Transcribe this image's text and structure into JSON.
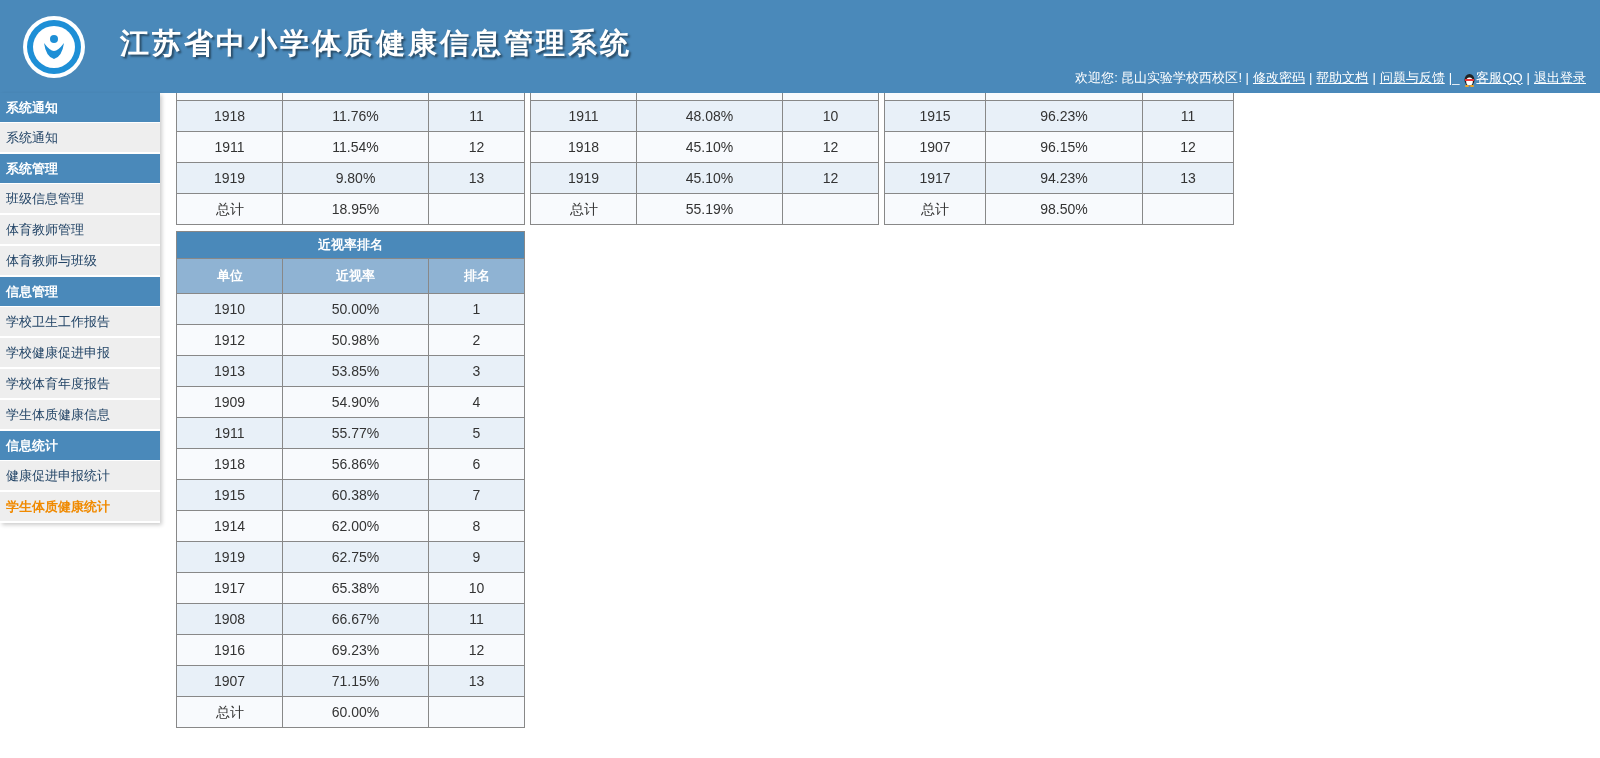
{
  "header": {
    "title": "江苏省中小学体质健康信息管理系统",
    "user_bar": [
      {
        "kind": "text",
        "text": "欢迎您: 昆山实验学校西校区! |"
      },
      {
        "kind": "link",
        "text": "修改密码"
      },
      {
        "kind": "text",
        "text": "|"
      },
      {
        "kind": "link",
        "text": "帮助文档"
      },
      {
        "kind": "text",
        "text": "|"
      },
      {
        "kind": "link",
        "text": "问题与反馈"
      },
      {
        "kind": "text",
        "text": "|_"
      },
      {
        "kind": "qq_link",
        "text": "客服QQ"
      },
      {
        "kind": "text",
        "text": "|"
      },
      {
        "kind": "link",
        "text": "退出登录"
      }
    ]
  },
  "sidebar": {
    "items": [
      {
        "kind": "section",
        "label": "系统通知",
        "selected": false
      },
      {
        "kind": "item",
        "label": "系统通知",
        "selected": false
      },
      {
        "kind": "section",
        "label": "系统管理",
        "selected": false
      },
      {
        "kind": "item",
        "label": "班级信息管理",
        "selected": false
      },
      {
        "kind": "item",
        "label": "体育教师管理",
        "selected": false
      },
      {
        "kind": "item",
        "label": "体育教师与班级",
        "selected": false
      },
      {
        "kind": "section",
        "label": "信息管理",
        "selected": false
      },
      {
        "kind": "item",
        "label": "学校卫生工作报告",
        "selected": false
      },
      {
        "kind": "item",
        "label": "学校健康促进申报",
        "selected": false
      },
      {
        "kind": "item",
        "label": "学校体育年度报告",
        "selected": false
      },
      {
        "kind": "item",
        "label": "学生体质健康信息",
        "selected": false
      },
      {
        "kind": "section",
        "label": "信息统计",
        "selected": false
      },
      {
        "kind": "item",
        "label": "健康促进申报统计",
        "selected": false
      },
      {
        "kind": "item",
        "label": "学生体质健康统计",
        "selected": true
      }
    ]
  },
  "top_tables": [
    {
      "rows": [
        [
          "1918",
          "11.76%",
          "11"
        ],
        [
          "1911",
          "11.54%",
          "12"
        ],
        [
          "1919",
          "9.80%",
          "13"
        ],
        [
          "总计",
          "18.95%",
          ""
        ]
      ]
    },
    {
      "rows": [
        [
          "1911",
          "48.08%",
          "10"
        ],
        [
          "1918",
          "45.10%",
          "12"
        ],
        [
          "1919",
          "45.10%",
          "12"
        ],
        [
          "总计",
          "55.19%",
          ""
        ]
      ]
    },
    {
      "rows": [
        [
          "1915",
          "96.23%",
          "11"
        ],
        [
          "1907",
          "96.15%",
          "12"
        ],
        [
          "1917",
          "94.23%",
          "13"
        ],
        [
          "总计",
          "98.50%",
          ""
        ]
      ]
    }
  ],
  "myopia_table": {
    "title": "近视率排名",
    "columns": [
      "单位",
      "近视率",
      "排名"
    ],
    "rows": [
      [
        "1910",
        "50.00%",
        "1"
      ],
      [
        "1912",
        "50.98%",
        "2"
      ],
      [
        "1913",
        "53.85%",
        "3"
      ],
      [
        "1909",
        "54.90%",
        "4"
      ],
      [
        "1911",
        "55.77%",
        "5"
      ],
      [
        "1918",
        "56.86%",
        "6"
      ],
      [
        "1915",
        "60.38%",
        "7"
      ],
      [
        "1914",
        "62.00%",
        "8"
      ],
      [
        "1919",
        "62.75%",
        "9"
      ],
      [
        "1917",
        "65.38%",
        "10"
      ],
      [
        "1908",
        "66.67%",
        "11"
      ],
      [
        "1916",
        "69.23%",
        "12"
      ],
      [
        "1907",
        "71.15%",
        "13"
      ],
      [
        "总计",
        "60.00%",
        ""
      ]
    ]
  }
}
